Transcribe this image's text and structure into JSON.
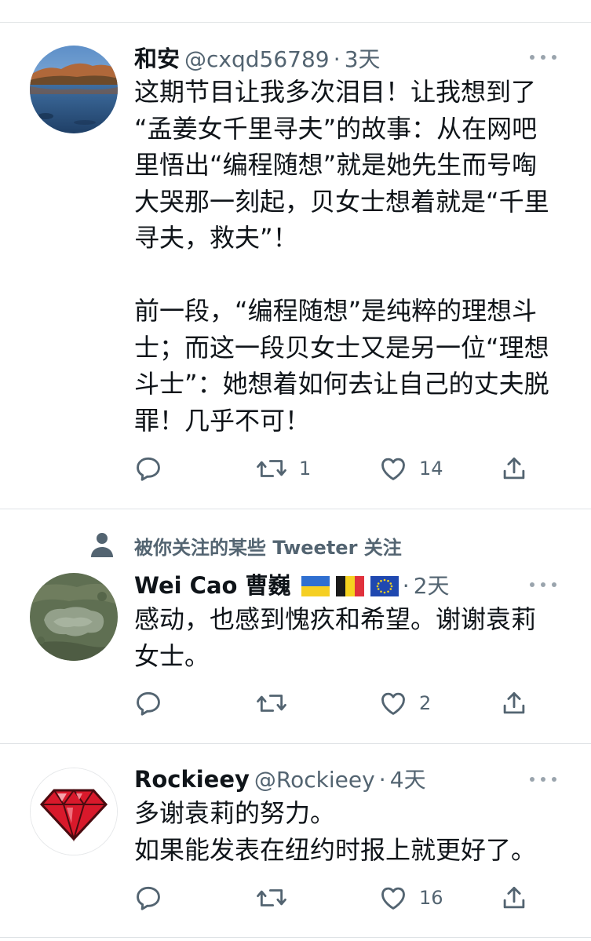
{
  "tweets": [
    {
      "name": "和安",
      "handle": "@cxqd56789",
      "dot": "·",
      "time": "3天",
      "avatar_icon": "lake-landscape-avatar",
      "text": "这期节目让我多次泪目！让我想到了\n“孟姜女千里寻夫”的故事：从在网吧\n里悟出“编程随想”就是她先生而号啕\n大哭那一刻起，贝女士想着就是“千里\n寻夫，救夫”！\n\n前一段，“编程随想”是纯粹的理想斗\n士；而这一段贝女士又是另一位“理想\n斗士”：她想着如何去让自己的丈夫脱\n罪！几乎不可！",
      "reply_count": "",
      "retweet_count": "1",
      "like_count": "14"
    },
    {
      "social_context": "被你关注的某些 Tweeter 关注",
      "name": "Wei Cao 曹巍",
      "flags": [
        "ukraine-flag",
        "belgium-flag",
        "eu-flag"
      ],
      "dot": "·",
      "time": "2天",
      "avatar_icon": "satellite-map-avatar",
      "text": "感动，也感到愧疚和希望。谢谢袁莉\n女士。",
      "reply_count": "",
      "retweet_count": "",
      "like_count": "2"
    },
    {
      "name": "Rockieey",
      "handle": "@Rockieey",
      "dot": "·",
      "time": "4天",
      "avatar_icon": "ruby-gem-avatar",
      "text": "多谢袁莉的努力。\n如果能发表在纽约时报上就更好了。",
      "reply_count": "",
      "retweet_count": "",
      "like_count": "16"
    }
  ],
  "colors": {
    "text": "#0f1419",
    "secondary": "#536471",
    "divider": "#dfe3e6",
    "icon": "#536471"
  }
}
